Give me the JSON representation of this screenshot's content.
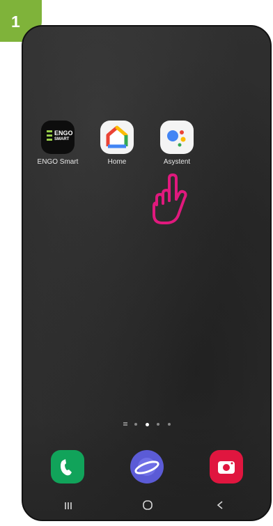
{
  "step": {
    "number": "1"
  },
  "colors": {
    "badge": "#7fb33a",
    "pointer": "#e0197d",
    "phone_call": "#11a35a",
    "internet": "#5b5bd6",
    "camera": "#e0163f"
  },
  "apps": [
    {
      "label": "ENGO Smart",
      "icon": "engo-smart-icon",
      "logo_text": "ENGO",
      "logo_subtext": "SMART"
    },
    {
      "label": "Home",
      "icon": "google-home-icon"
    },
    {
      "label": "Asystent",
      "icon": "google-assistant-icon"
    }
  ],
  "home_pages": {
    "count": 5,
    "active_index": 2
  },
  "dock": [
    {
      "icon": "phone-icon"
    },
    {
      "icon": "internet-icon"
    },
    {
      "icon": "camera-icon"
    }
  ],
  "navigation": {
    "recents": "recents-icon",
    "home": "home-icon",
    "back": "back-icon"
  },
  "annotation": {
    "icon": "tap-hand-icon",
    "target": "Asystent"
  }
}
